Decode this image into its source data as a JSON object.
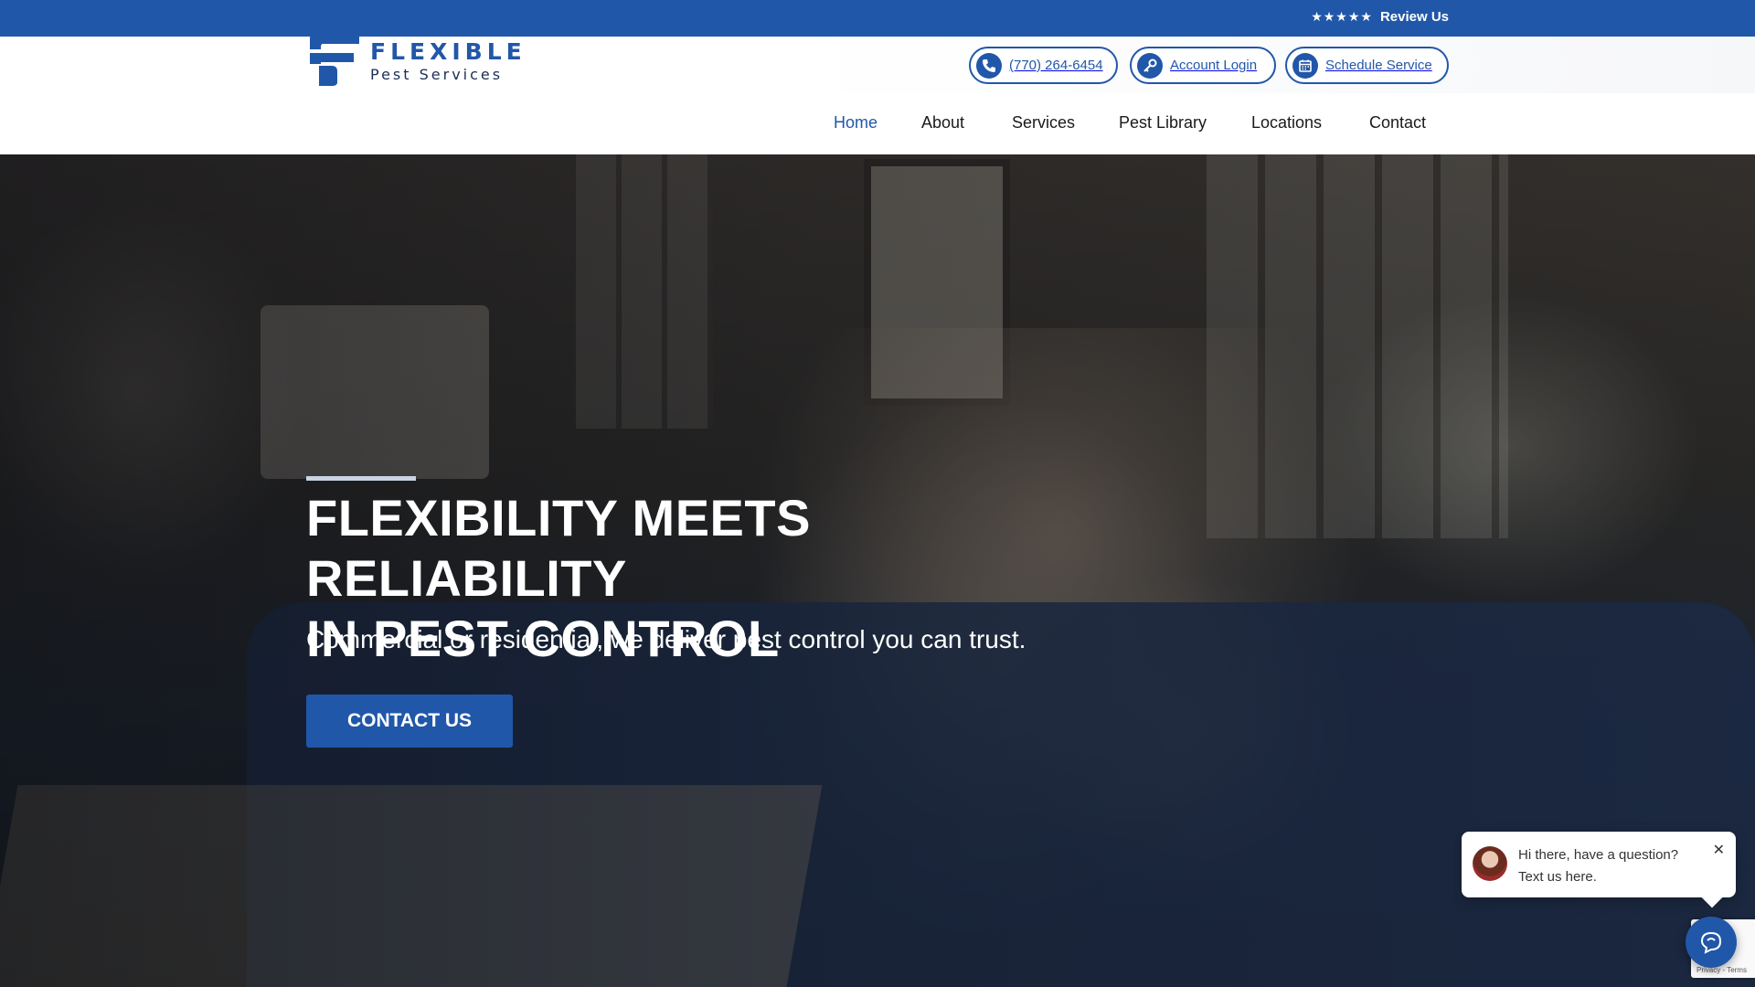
{
  "topbar": {
    "stars": "★★★★★",
    "review_label": "Review Us"
  },
  "brand": {
    "title": "FLEXIBLE",
    "subtitle": "Pest Services",
    "primary_color": "#2157a9"
  },
  "utility": {
    "phone": "(770) 264-6454",
    "login": "Account Login",
    "schedule": "Schedule Service"
  },
  "nav": {
    "items": [
      "Home",
      "About",
      "Services",
      "Pest Library",
      "Locations",
      "Contact"
    ],
    "active": "Home"
  },
  "hero": {
    "title_line1": "FLEXIBILITY MEETS RELIABILITY",
    "title_line2": "IN PEST CONTROL",
    "subtitle": "Commercial or residential, we deliver pest control you can trust.",
    "cta": "CONTACT US"
  },
  "chat": {
    "line1": "Hi there, have a question?",
    "line2": "Text us here.",
    "close": "✕"
  },
  "recaptcha": {
    "text": "Privacy - Terms"
  },
  "icons": {
    "phone": "phone-icon",
    "login": "key-icon",
    "schedule": "calendar-icon",
    "chat": "chat-icon"
  }
}
